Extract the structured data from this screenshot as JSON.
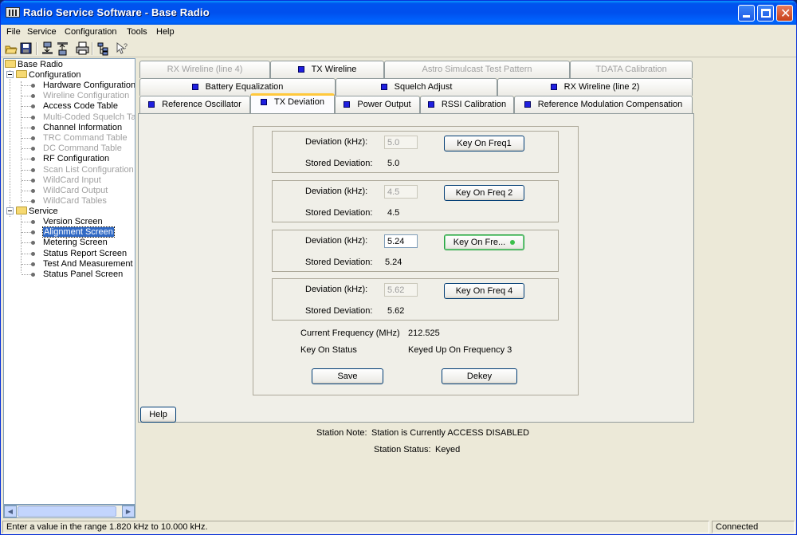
{
  "window": {
    "title": "Radio Service Software - Base Radio"
  },
  "menu": [
    "File",
    "Service",
    "Configuration",
    "Tools",
    "Help"
  ],
  "toolbar": [
    "open-icon",
    "save-icon",
    "read-radio-icon",
    "write-radio-icon",
    "print-icon",
    "tree-icon",
    "context-help-icon"
  ],
  "tree": {
    "root": "Base Radio",
    "configuration": {
      "label": "Configuration",
      "items": [
        {
          "label": "Hardware Configuration",
          "enabled": true
        },
        {
          "label": "Wireline Configuration",
          "enabled": false
        },
        {
          "label": "Access Code Table",
          "enabled": true
        },
        {
          "label": "Multi-Coded Squelch Tab",
          "enabled": false
        },
        {
          "label": "Channel Information",
          "enabled": true
        },
        {
          "label": "TRC Command Table",
          "enabled": false
        },
        {
          "label": "DC Command Table",
          "enabled": false
        },
        {
          "label": "RF Configuration",
          "enabled": true
        },
        {
          "label": "Scan List Configuration",
          "enabled": false
        },
        {
          "label": "WildCard Input",
          "enabled": false
        },
        {
          "label": "WildCard Output",
          "enabled": false
        },
        {
          "label": "WildCard Tables",
          "enabled": false
        }
      ]
    },
    "service": {
      "label": "Service",
      "items": [
        {
          "label": "Version Screen",
          "selected": false
        },
        {
          "label": "Alignment Screen",
          "selected": true
        },
        {
          "label": "Metering Screen",
          "selected": false
        },
        {
          "label": "Status Report Screen",
          "selected": false
        },
        {
          "label": "Test And Measurement S",
          "selected": false
        },
        {
          "label": "Status Panel Screen",
          "selected": false
        }
      ]
    }
  },
  "tabs": {
    "row1": [
      {
        "label": "RX Wireline (line 4)",
        "enabled": false,
        "checked": false
      },
      {
        "label": "TX Wireline",
        "enabled": true,
        "checked": true
      },
      {
        "label": "Astro Simulcast Test Pattern",
        "enabled": false,
        "checked": false
      },
      {
        "label": "TDATA Calibration",
        "enabled": false,
        "checked": false
      }
    ],
    "row2": [
      {
        "label": "Battery Equalization",
        "enabled": true,
        "checked": true
      },
      {
        "label": "Squelch Adjust",
        "enabled": true,
        "checked": true
      },
      {
        "label": "RX Wireline (line 2)",
        "enabled": true,
        "checked": true
      }
    ],
    "row3": [
      {
        "label": "Reference Oscillator",
        "enabled": true,
        "checked": true
      },
      {
        "label": "TX Deviation",
        "enabled": true,
        "checked": true,
        "active": true
      },
      {
        "label": "Power Output",
        "enabled": true,
        "checked": true
      },
      {
        "label": "RSSI Calibration",
        "enabled": true,
        "checked": true
      },
      {
        "label": "Reference Modulation Compensation",
        "enabled": true,
        "checked": true
      }
    ]
  },
  "tx_deviation": {
    "deviation_label": "Deviation (kHz):",
    "stored_label": "Stored Deviation:",
    "freqs": [
      {
        "value": "5.0",
        "stored": "5.0",
        "button": "Key On Freq1",
        "enabled": false,
        "keyed": false
      },
      {
        "value": "4.5",
        "stored": "4.5",
        "button": "Key On Freq 2",
        "enabled": false,
        "keyed": false
      },
      {
        "value": "5.24",
        "stored": "5.24",
        "button": "Key On Fre...",
        "enabled": true,
        "keyed": true
      },
      {
        "value": "5.62",
        "stored": "5.62",
        "button": "Key On Freq 4",
        "enabled": false,
        "keyed": false
      }
    ],
    "current_freq_label": "Current Frequency (MHz)",
    "current_freq_value": "212.525",
    "key_on_status_label": "Key On Status",
    "key_on_status_value": "Keyed Up On Frequency 3",
    "save_label": "Save",
    "dekey_label": "Dekey"
  },
  "help_label": "Help",
  "station": {
    "note_label": "Station Note:",
    "note_value": "Station is Currently ACCESS DISABLED",
    "status_label": "Station Status:",
    "status_value": "Keyed"
  },
  "statusbar": {
    "hint": "Enter a value in the range 1.820 kHz to 10.000 kHz.",
    "connection": "Connected"
  }
}
